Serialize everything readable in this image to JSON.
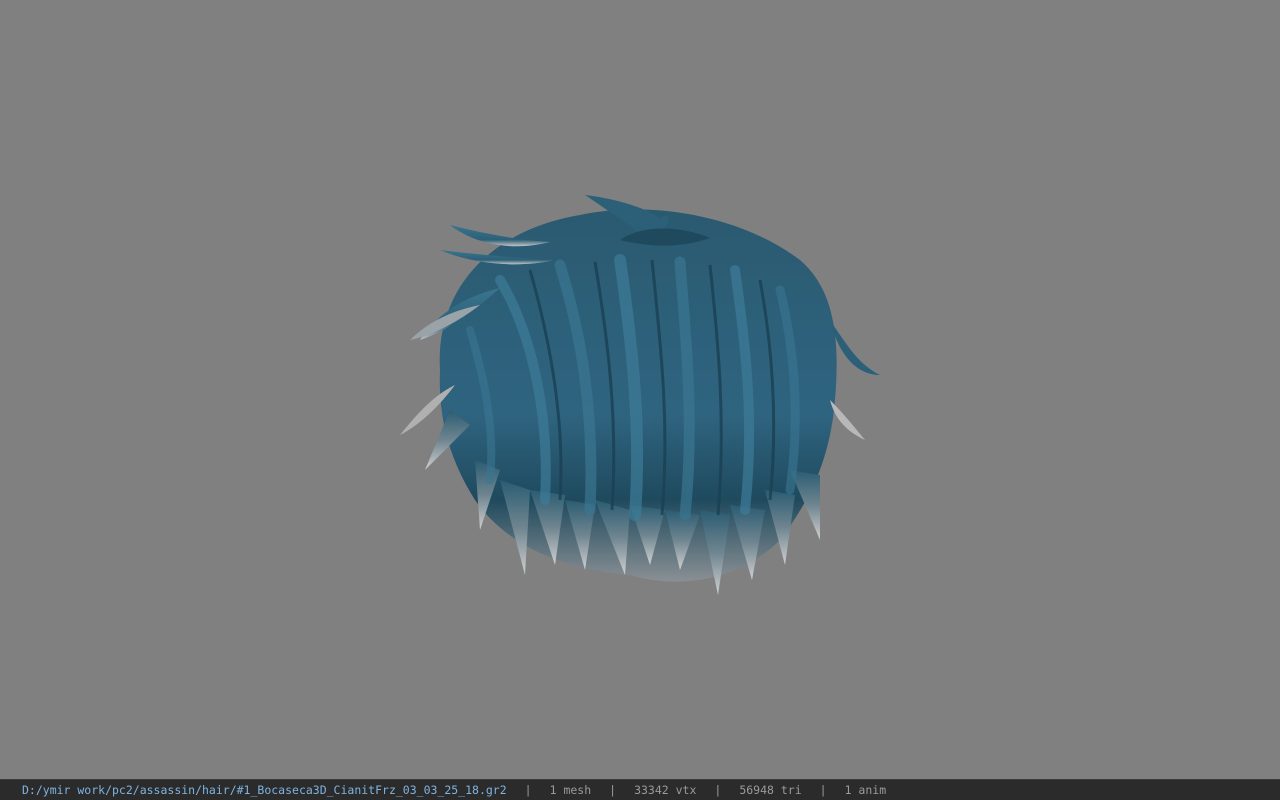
{
  "viewport": {
    "background_color": "#808080",
    "model_name": "hair-mesh-preview",
    "hair_color": "#2e5f78",
    "tip_color": "#b8b8b8"
  },
  "status_bar": {
    "file_path": "D:/ymir work/pc2/assassin/hair/#1_Bocaseca3D_CianitFrz_03_03_25_18.gr2",
    "separator": "|",
    "mesh_count": "1 mesh",
    "vertex_count": "33342 vtx",
    "triangle_count": "56948 tri",
    "anim_count": "1 anim",
    "path_color": "#7fb3e0",
    "text_color": "#9a9a9a"
  }
}
